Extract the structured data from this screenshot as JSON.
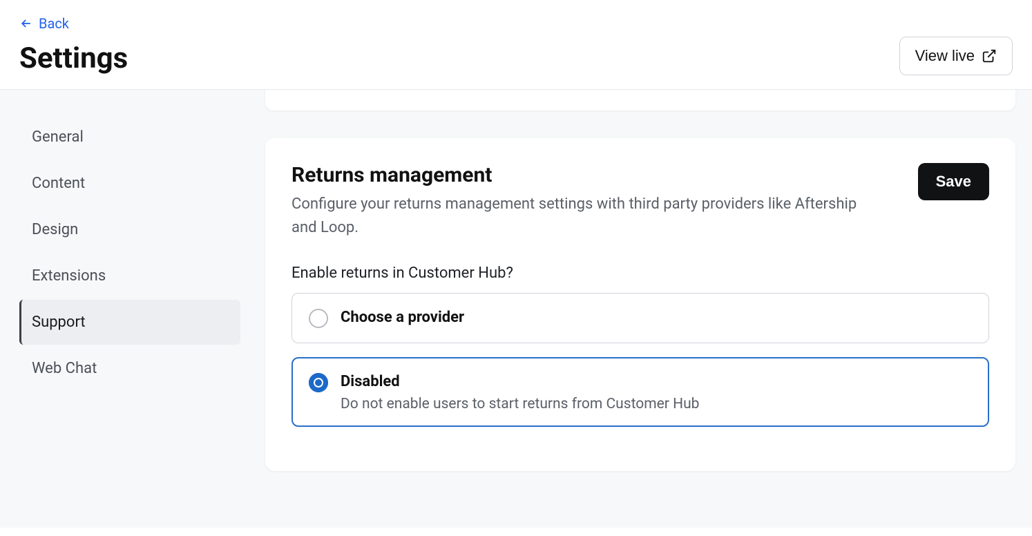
{
  "header": {
    "back_label": "Back",
    "title": "Settings",
    "view_live_label": "View live"
  },
  "sidebar": {
    "items": [
      {
        "label": "General",
        "active": false
      },
      {
        "label": "Content",
        "active": false
      },
      {
        "label": "Design",
        "active": false
      },
      {
        "label": "Extensions",
        "active": false
      },
      {
        "label": "Support",
        "active": true
      },
      {
        "label": "Web Chat",
        "active": false
      }
    ]
  },
  "main": {
    "returns_card": {
      "title": "Returns management",
      "description": "Configure your returns management settings with third party providers like Aftership and Loop.",
      "save_label": "Save",
      "field_label": "Enable returns in Customer Hub?",
      "options": [
        {
          "title": "Choose a provider",
          "desc": "",
          "selected": false
        },
        {
          "title": "Disabled",
          "desc": "Do not enable users to start returns from Customer Hub",
          "selected": true
        }
      ]
    }
  }
}
